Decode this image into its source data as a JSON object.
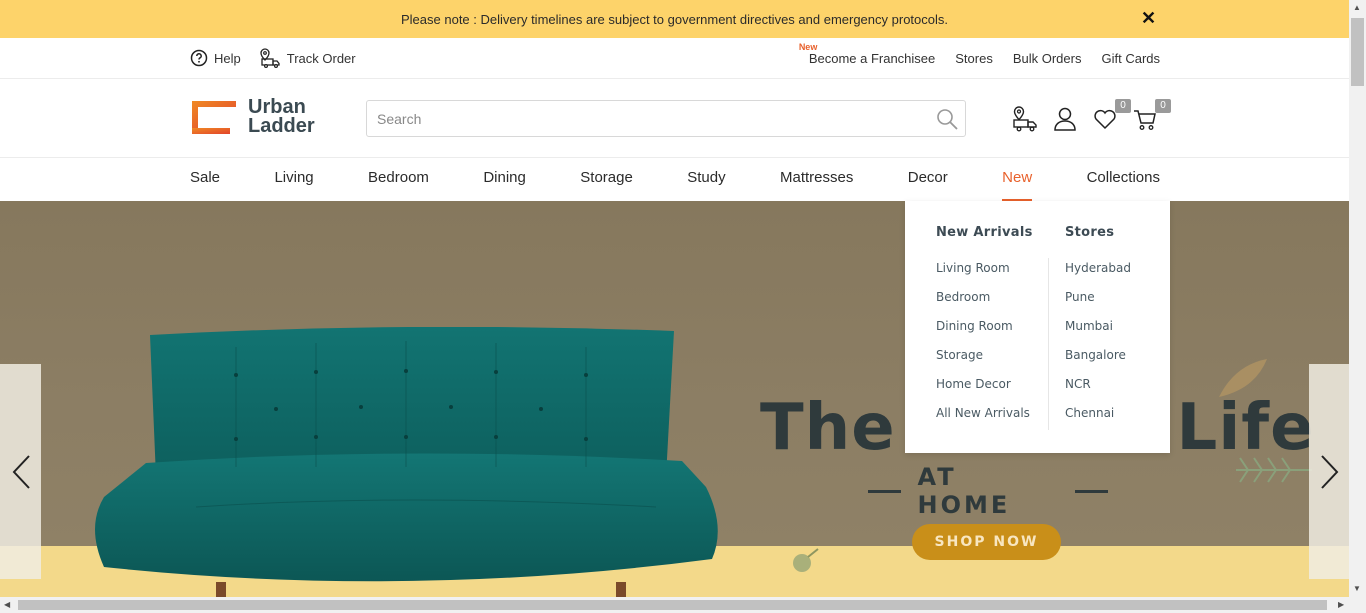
{
  "notice": {
    "text": "Please note : Delivery timelines are subject to government directives and emergency protocols.",
    "close_label": "✕"
  },
  "utility": {
    "help": "Help",
    "track_order": "Track Order",
    "new_tag": "New",
    "franchise": "Become a Franchisee",
    "stores": "Stores",
    "bulk_orders": "Bulk Orders",
    "gift_cards": "Gift Cards"
  },
  "header": {
    "logo_line1": "Urban",
    "logo_line2": "Ladder",
    "search_placeholder": "Search",
    "wishlist_count": "0",
    "cart_count": "0"
  },
  "nav": {
    "items": [
      "Sale",
      "Living",
      "Bedroom",
      "Dining",
      "Storage",
      "Study",
      "Mattresses",
      "Decor",
      "New",
      "Collections"
    ],
    "active": "New"
  },
  "dropdown": {
    "col1_title": "New Arrivals",
    "col1_links": [
      "Living Room",
      "Bedroom",
      "Dining Room",
      "Storage",
      "Home Decor",
      "All New Arrivals"
    ],
    "col2_title": "Stores",
    "col2_links": [
      "Hyderabad",
      "Pune",
      "Mumbai",
      "Bangalore",
      "NCR",
      "Chennai"
    ]
  },
  "hero": {
    "title": "The Better Life",
    "subtitle": "AT HOME",
    "cta": "SHOP NOW"
  },
  "colors": {
    "accent": "#e8612c",
    "notice_bg": "#fdd36a",
    "sofa": "#116d6b",
    "cta_bg": "#c98f19"
  }
}
